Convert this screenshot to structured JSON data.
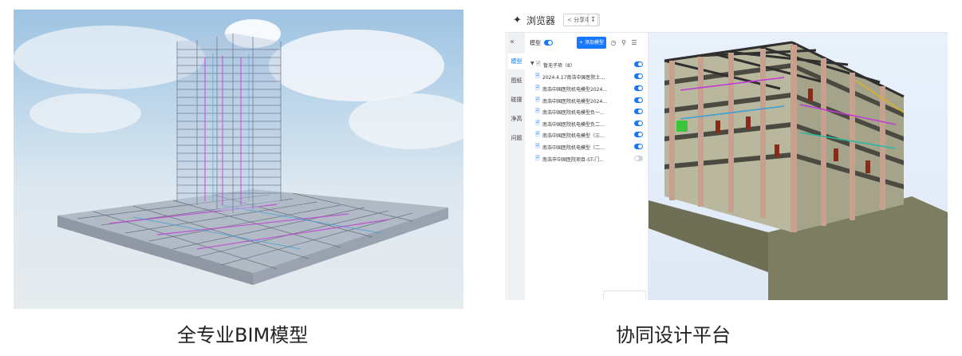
{
  "captions": {
    "left": "全专业BIM模型",
    "right": "协同设计平台"
  },
  "platform": {
    "title": "浏览器",
    "share_label": "分享中...",
    "download_icon": "download-icon",
    "nav_tabs": [
      "模型",
      "图纸",
      "碰撞",
      "净高",
      "问题"
    ],
    "active_tab": "模型",
    "model_label": "模型",
    "add_model_label": "添加模型",
    "group": {
      "label": "暂无子项（8）",
      "expanded": true
    },
    "files": [
      {
        "name": "2024.4.17南浩中国医院土...",
        "visible": true
      },
      {
        "name": "南浩中国医院机电模型2024...",
        "visible": true
      },
      {
        "name": "南浩中国医院机电模型2024...",
        "visible": true
      },
      {
        "name": "南浩中国医院机电模型负一...",
        "visible": true
      },
      {
        "name": "南浩中国医院机电模型负二...",
        "visible": true
      },
      {
        "name": "南浩中国医院机电模型（三...",
        "visible": true
      },
      {
        "name": "南浩中国医院机电模型（二...",
        "visible": true
      },
      {
        "name": "南浩市中国医院项目-ST-门...",
        "visible": false
      }
    ],
    "accent_color": "#1677ff"
  }
}
